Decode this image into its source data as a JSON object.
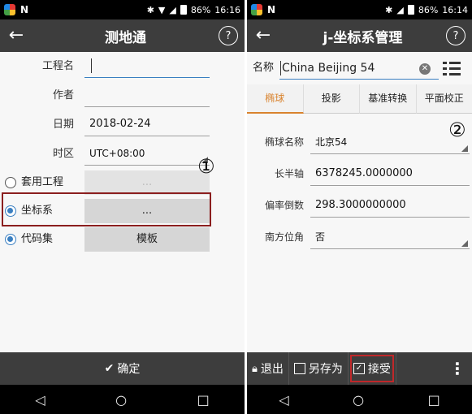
{
  "left": {
    "status": {
      "battery": "86%",
      "time": "16:16"
    },
    "toolbar": {
      "back": "←",
      "title": "测地通",
      "help": "?"
    },
    "form": {
      "project_label": "工程名",
      "project_value": "",
      "author_label": "作者",
      "author_value": "",
      "date_label": "日期",
      "date_value": "2018-02-24",
      "timezone_label": "时区",
      "timezone_value": "UTC+08:00"
    },
    "options": {
      "apply_project_label": "套用工程",
      "apply_project_button": "...",
      "coord_system_label": "坐标系",
      "coord_system_button": "...",
      "code_set_label": "代码集",
      "code_set_button": "模板"
    },
    "marker": "①",
    "confirm_icon": "✔",
    "confirm_label": "确定",
    "nav": {
      "back": "◁",
      "home": "○",
      "recents": "□"
    }
  },
  "right": {
    "status": {
      "battery": "86%",
      "time": "16:14"
    },
    "toolbar": {
      "back": "←",
      "title": "j-坐标系管理",
      "help": "?"
    },
    "name_label": "名称",
    "name_value": "China Beijing 54",
    "clear_icon": "✕",
    "tabs": [
      "椭球",
      "投影",
      "基准转换",
      "平面校正"
    ],
    "marker": "②",
    "fields": {
      "ellipsoid_name_label": "椭球名称",
      "ellipsoid_name_value": "北京54",
      "semi_major_label": "长半轴",
      "semi_major_value": "6378245.0000000",
      "inverse_flattening_label": "偏率倒数",
      "inverse_flattening_value": "298.3000000000",
      "south_azimuth_label": "南方位角",
      "south_azimuth_value": "否"
    },
    "actions": {
      "exit_label": "退出",
      "save_as_label": "另存为",
      "accept_label": "接受",
      "more": "⋮"
    },
    "nav": {
      "back": "◁",
      "home": "○",
      "recents": "□"
    }
  },
  "colors": {
    "toolbar": "#3d3d3d",
    "accent": "#3a7fc1",
    "active_tab": "#d9832e",
    "highlight_box": "#8b1e1e"
  }
}
